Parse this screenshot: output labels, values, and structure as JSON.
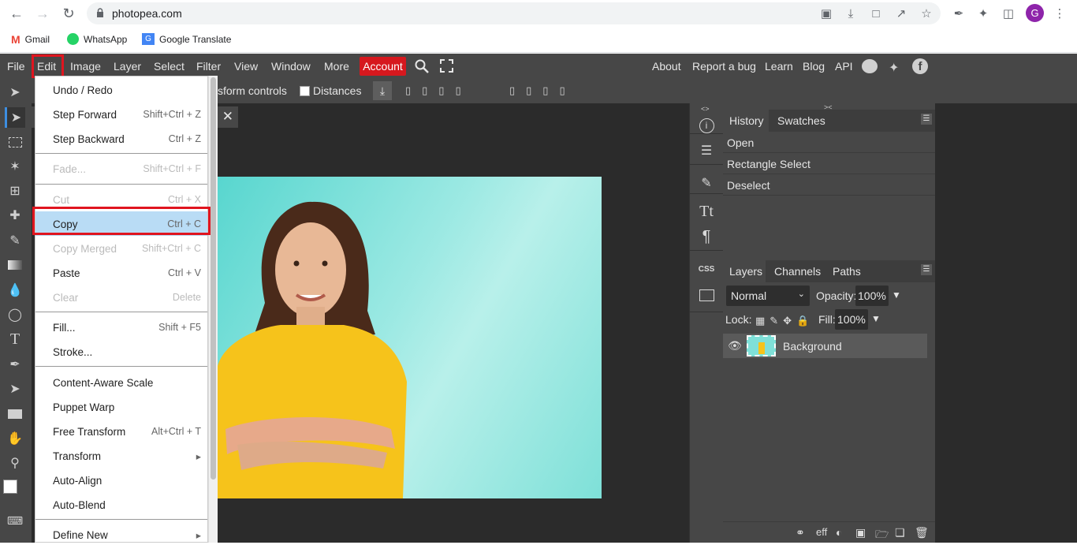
{
  "browser": {
    "url": "photopea.com",
    "profile_initial": "G",
    "bookmarks": [
      {
        "label": "Gmail",
        "icon": "gmail-icon"
      },
      {
        "label": "WhatsApp",
        "icon": "whatsapp-icon"
      },
      {
        "label": "Google Translate",
        "icon": "translate-icon"
      }
    ]
  },
  "menubar": {
    "items": [
      "File",
      "Edit",
      "Image",
      "Layer",
      "Select",
      "Filter",
      "View",
      "Window",
      "More"
    ],
    "account": "Account",
    "right_links": [
      "About",
      "Report a bug",
      "Learn",
      "Blog",
      "API"
    ],
    "accent_color": "#d6181e",
    "highlight_color": "#e0151f"
  },
  "options_bar": {
    "transform_controls": "sform controls",
    "distances": "Distances"
  },
  "edit_menu": {
    "items": [
      {
        "label": "Undo / Redo",
        "shortcut": "",
        "disabled": false
      },
      {
        "label": "Step Forward",
        "shortcut": "Shift+Ctrl + Z",
        "disabled": false
      },
      {
        "label": "Step Backward",
        "shortcut": "Ctrl + Z",
        "disabled": false
      },
      {
        "label": "Fade...",
        "shortcut": "Shift+Ctrl + F",
        "disabled": true
      },
      {
        "label": "Cut",
        "shortcut": "Ctrl + X",
        "disabled": true
      },
      {
        "label": "Copy",
        "shortcut": "Ctrl + C",
        "disabled": false
      },
      {
        "label": "Copy Merged",
        "shortcut": "Shift+Ctrl + C",
        "disabled": true
      },
      {
        "label": "Paste",
        "shortcut": "Ctrl + V",
        "disabled": false
      },
      {
        "label": "Clear",
        "shortcut": "Delete",
        "disabled": true
      },
      {
        "label": "Fill...",
        "shortcut": "Shift + F5",
        "disabled": false
      },
      {
        "label": "Stroke...",
        "shortcut": "",
        "disabled": false
      },
      {
        "label": "Content-Aware Scale",
        "shortcut": "",
        "disabled": false
      },
      {
        "label": "Puppet Warp",
        "shortcut": "",
        "disabled": false
      },
      {
        "label": "Free Transform",
        "shortcut": "Alt+Ctrl + T",
        "disabled": false
      },
      {
        "label": "Transform",
        "shortcut": "▸",
        "disabled": false
      },
      {
        "label": "Auto-Align",
        "shortcut": "",
        "disabled": false
      },
      {
        "label": "Auto-Blend",
        "shortcut": "",
        "disabled": false
      },
      {
        "label": "Define New",
        "shortcut": "▸",
        "disabled": false
      }
    ]
  },
  "history_panel": {
    "tabs": [
      "History",
      "Swatches"
    ],
    "entries": [
      "Open",
      "Rectangle Select",
      "Deselect"
    ]
  },
  "layers_panel": {
    "tabs": [
      "Layers",
      "Channels",
      "Paths"
    ],
    "blend_mode": "Normal",
    "opacity_label": "Opacity:",
    "opacity_value": "100%",
    "lock_label": "Lock:",
    "fill_label": "Fill:",
    "fill_value": "100%",
    "layer_name": "Background",
    "footer_eff": "eff"
  },
  "icon_column": {
    "css_label": "CSS"
  }
}
